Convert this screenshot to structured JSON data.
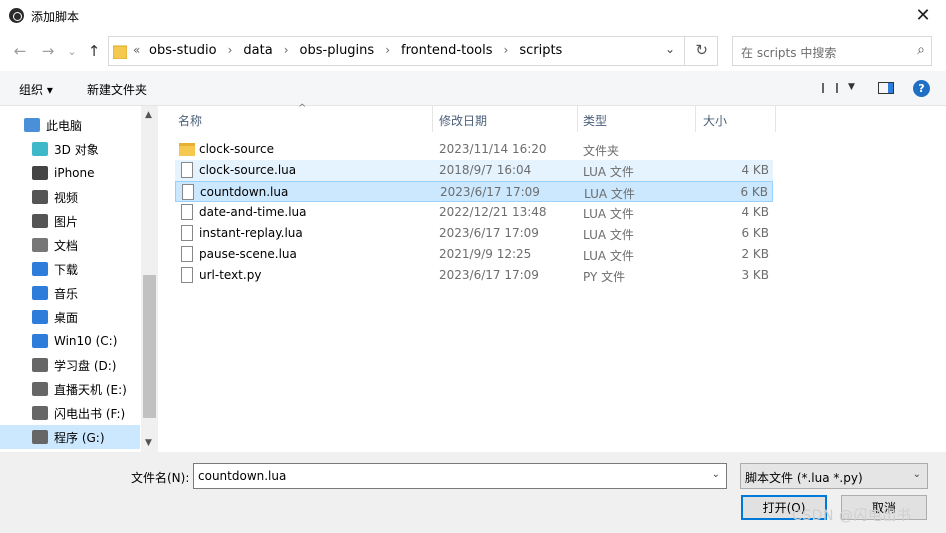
{
  "window": {
    "title": "添加脚本",
    "close_glyph": "✕"
  },
  "nav": {
    "back_glyph": "←",
    "forward_glyph": "→",
    "recent_glyph": "⌄",
    "up_glyph": "↑",
    "chevron": "«",
    "breadcrumbs": [
      "obs-studio",
      "data",
      "obs-plugins",
      "frontend-tools",
      "scripts"
    ],
    "separator": "›",
    "dropdown_glyph": "⌄",
    "refresh_glyph": "↻",
    "search_placeholder": "在 scripts 中搜索",
    "search_glyph": "⌕"
  },
  "toolbar": {
    "organize_label": "组织 ▾",
    "new_folder_label": "新建文件夹",
    "view_dropdown_glyph": "▼",
    "help_glyph": "?"
  },
  "sidebar": {
    "items": [
      {
        "label": "此电脑",
        "icon": "computer-icon"
      },
      {
        "label": "3D 对象",
        "icon": "3d-objects-icon"
      },
      {
        "label": "iPhone",
        "icon": "phone-icon"
      },
      {
        "label": "视频",
        "icon": "video-icon"
      },
      {
        "label": "图片",
        "icon": "picture-icon"
      },
      {
        "label": "文档",
        "icon": "document-icon"
      },
      {
        "label": "下载",
        "icon": "download-icon"
      },
      {
        "label": "音乐",
        "icon": "music-icon"
      },
      {
        "label": "桌面",
        "icon": "desktop-icon"
      },
      {
        "label": "Win10 (C:)",
        "icon": "windows-drive-icon"
      },
      {
        "label": "学习盘 (D:)",
        "icon": "drive-icon"
      },
      {
        "label": "直播天机 (E:)",
        "icon": "drive-icon"
      },
      {
        "label": "闪电出书 (F:)",
        "icon": "drive-icon"
      },
      {
        "label": "程序 (G:)",
        "icon": "drive-icon"
      }
    ],
    "selected_index": 13,
    "scroll_up_glyph": "▲",
    "scroll_down_glyph": "▼"
  },
  "columns": {
    "name": "名称",
    "date": "修改日期",
    "type": "类型",
    "size": "大小",
    "sort_caret": "^"
  },
  "files": [
    {
      "name": "clock-source",
      "date": "2023/11/14 16:20",
      "type": "文件夹",
      "size": "",
      "kind": "folder"
    },
    {
      "name": "clock-source.lua",
      "date": "2018/9/7 16:04",
      "type": "LUA 文件",
      "size": "4 KB",
      "kind": "file"
    },
    {
      "name": "countdown.lua",
      "date": "2023/6/17 17:09",
      "type": "LUA 文件",
      "size": "6 KB",
      "kind": "file"
    },
    {
      "name": "date-and-time.lua",
      "date": "2022/12/21 13:48",
      "type": "LUA 文件",
      "size": "4 KB",
      "kind": "file"
    },
    {
      "name": "instant-replay.lua",
      "date": "2023/6/17 17:09",
      "type": "LUA 文件",
      "size": "6 KB",
      "kind": "file"
    },
    {
      "name": "pause-scene.lua",
      "date": "2021/9/9 12:25",
      "type": "LUA 文件",
      "size": "2 KB",
      "kind": "file"
    },
    {
      "name": "url-text.py",
      "date": "2023/6/17 17:09",
      "type": "PY 文件",
      "size": "3 KB",
      "kind": "file"
    }
  ],
  "hover_index": 1,
  "selected_file_index": 2,
  "footer": {
    "filename_label": "文件名(N):",
    "filename_value": "countdown.lua",
    "filetype_value": "脚本文件 (*.lua *.py)",
    "dropdown_glyph": "⌄",
    "open_label": "打开(O)",
    "cancel_label": "取消"
  },
  "watermark": "CSDN @闪电出书",
  "colors": {
    "selection": "#cce8ff",
    "hover": "#e5f3ff",
    "accent": "#0078d7"
  }
}
